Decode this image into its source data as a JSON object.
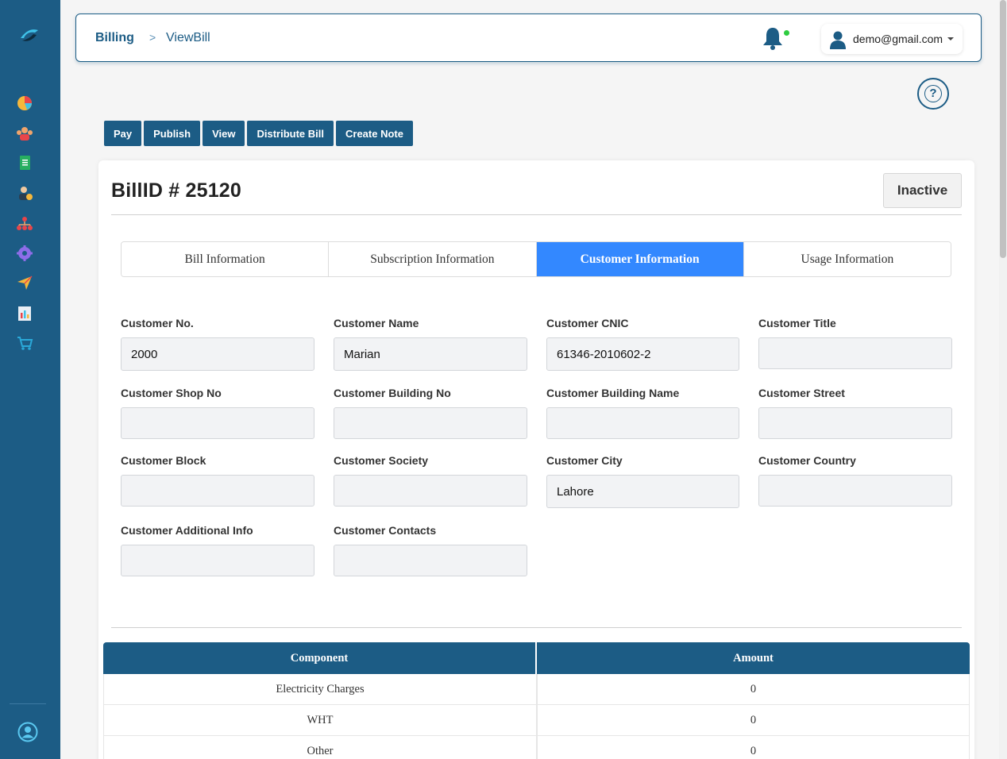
{
  "breadcrumb": {
    "section": "Billing",
    "separator": ">",
    "page": "ViewBill"
  },
  "user": {
    "email": "demo@gmail.com"
  },
  "help": {
    "label": "?"
  },
  "actions": [
    {
      "label": "Pay"
    },
    {
      "label": "Publish"
    },
    {
      "label": "View"
    },
    {
      "label": "Distribute Bill"
    },
    {
      "label": "Create Note"
    }
  ],
  "bill": {
    "title": "BillID # 25120",
    "status": "Inactive"
  },
  "tabs": [
    {
      "label": "Bill Information"
    },
    {
      "label": "Subscription Information"
    },
    {
      "label": "Customer Information"
    },
    {
      "label": "Usage Information"
    }
  ],
  "fields": [
    {
      "label": "Customer No.",
      "value": "2000"
    },
    {
      "label": "Customer Name",
      "value": "Marian"
    },
    {
      "label": "Customer CNIC",
      "value": "61346-2010602-2"
    },
    {
      "label": "Customer Title",
      "value": ""
    },
    {
      "label": "Customer Shop No",
      "value": ""
    },
    {
      "label": "Customer Building No",
      "value": ""
    },
    {
      "label": "Customer Building Name",
      "value": ""
    },
    {
      "label": "Customer Street",
      "value": ""
    },
    {
      "label": "Customer Block",
      "value": ""
    },
    {
      "label": "Customer Society",
      "value": ""
    },
    {
      "label": "Customer City",
      "value": "Lahore"
    },
    {
      "label": "Customer Country",
      "value": ""
    },
    {
      "label": "Customer Additional Info",
      "value": ""
    },
    {
      "label": "Customer Contacts",
      "value": ""
    }
  ],
  "table": {
    "headers": [
      "Component",
      "Amount"
    ],
    "rows": [
      [
        "Electricity Charges",
        "0"
      ],
      [
        "WHT",
        "0"
      ],
      [
        "Other",
        "0"
      ]
    ]
  },
  "colors": {
    "primary": "#1c5c85",
    "active_tab": "#3388ff",
    "notification_dot": "#2ecc40"
  },
  "sidebar_icons": [
    "dashboard-icon",
    "customers-icon",
    "bills-icon",
    "users-icon",
    "hierarchy-icon",
    "settings-icon",
    "send-icon",
    "reports-icon",
    "cart-icon"
  ]
}
